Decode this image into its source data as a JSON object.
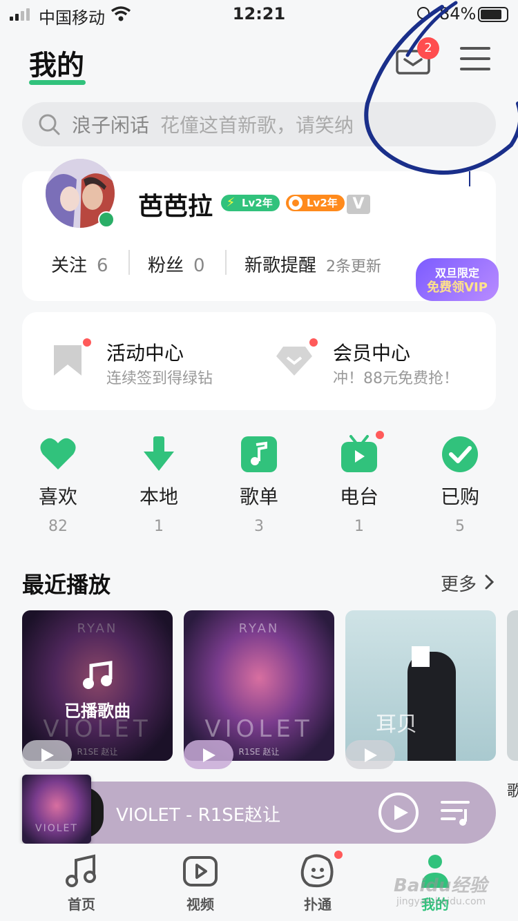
{
  "status": {
    "carrier": "中国移动",
    "time": "12:21",
    "battery": "84%"
  },
  "header": {
    "title": "我的",
    "mail_badge": "2"
  },
  "search": {
    "hint": "浪子闲话",
    "hint2": "花僮这首新歌，请笑纳"
  },
  "profile": {
    "name": "芭芭拉",
    "badge1": "Lv2年",
    "badge2": "Lv2年",
    "vip_letter": "V",
    "stats": [
      {
        "label": "关注",
        "value": "6"
      },
      {
        "label": "粉丝",
        "value": "0"
      },
      {
        "label": "新歌提醒",
        "value": "2条更新"
      }
    ],
    "promo_line1": "双旦限定",
    "promo_line2": "免费领VIP"
  },
  "activities": [
    {
      "title": "活动中心",
      "sub": "连续签到得绿钻"
    },
    {
      "title": "会员中心",
      "sub": "冲！88元免费抢！"
    }
  ],
  "quick": [
    {
      "label": "喜欢",
      "count": "82"
    },
    {
      "label": "本地",
      "count": "1"
    },
    {
      "label": "歌单",
      "count": "3"
    },
    {
      "label": "电台",
      "count": "1"
    },
    {
      "label": "已购",
      "count": "5"
    }
  ],
  "recent": {
    "title": "最近播放",
    "more": "更多",
    "played_label": "已播歌曲",
    "partial_text": "歌",
    "albums": [
      {
        "brand": "RYAN",
        "big": "VIOLET",
        "small": "R1SE 赵让"
      },
      {
        "brand": "RYAN",
        "big": "VIOLET",
        "small": "R1SE 赵让"
      },
      {
        "vert": "耳贝"
      }
    ]
  },
  "player": {
    "title": "VIOLET - R1SE赵让",
    "cover_text": "VIOLET"
  },
  "tabs": [
    {
      "label": "首页"
    },
    {
      "label": "视频"
    },
    {
      "label": "扑通"
    },
    {
      "label": "我的"
    }
  ],
  "watermark": {
    "main": "Baidu经验",
    "sub": "jingyan.baidu.com"
  },
  "colors": {
    "accent": "#31c27c",
    "badge_red": "#ff4d4f",
    "player_bg": "#baa8c4"
  }
}
